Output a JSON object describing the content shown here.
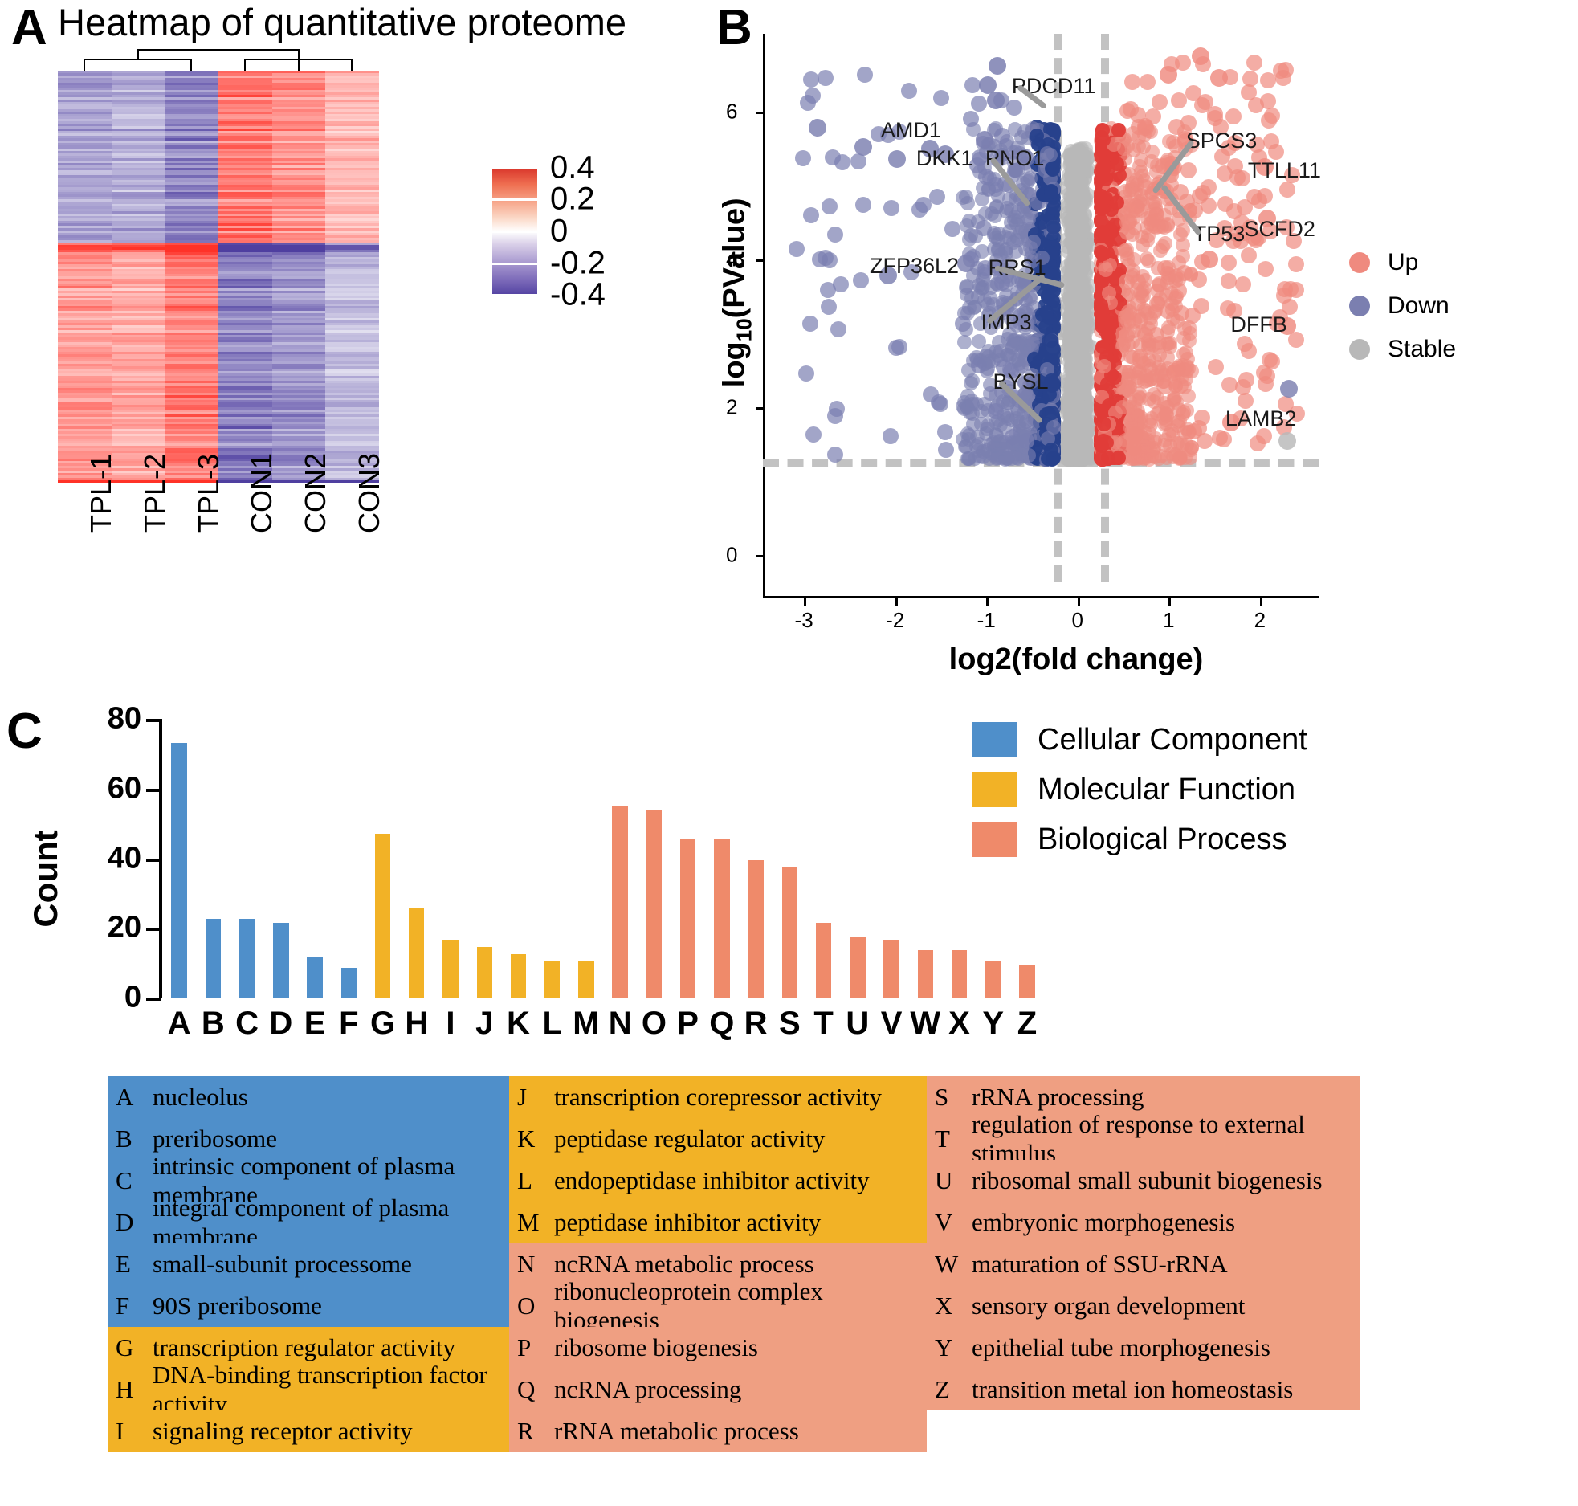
{
  "panels": {
    "a": "A",
    "b": "B",
    "c": "C"
  },
  "heatmap": {
    "title": "Heatmap of quantitative proteome",
    "columns": [
      "TPL-1",
      "TPL-2",
      "TPL-3",
      "CON1",
      "CON2",
      "CON3"
    ],
    "colorbar": {
      "ticks": [
        "0.4",
        "0.2",
        "0",
        "-0.2",
        "-0.4"
      ],
      "high_color": "#d73027",
      "mid_color": "#ffffff",
      "low_color": "#4f3fa0"
    }
  },
  "volcano": {
    "xlabel": "log2(fold change)",
    "ylabel_main": "log",
    "ylabel_sub": "10",
    "ylabel_tail": "(PValue)",
    "x_ticks": [
      "-3",
      "-2",
      "-1",
      "0",
      "1",
      "2"
    ],
    "y_ticks": [
      "0",
      "2",
      "4",
      "6"
    ],
    "legend": [
      {
        "label": "Up",
        "color": "#ef8a7f"
      },
      {
        "label": "Down",
        "color": "#7b7fb0"
      },
      {
        "label": "Stable",
        "color": "#b8b8b8"
      }
    ],
    "gene_labels": [
      "PDCD11",
      "AMD1",
      "DKK1",
      "PNO1",
      "SPCS3",
      "TTLL11",
      "SCFD2",
      "ZFP36L2",
      "RRS1",
      "TP53",
      "DFFB",
      "IMP3",
      "BYSL",
      "LAMB2"
    ],
    "thresholds": {
      "fc_left": -0.26,
      "fc_right": 0.26,
      "pvalue_line": 1.3
    }
  },
  "chart_data": {
    "type": "bar",
    "title": "",
    "xlabel": "",
    "ylabel": "Count",
    "ylim": [
      0,
      80
    ],
    "y_ticks": [
      0,
      20,
      40,
      60,
      80
    ],
    "categories": [
      "A",
      "B",
      "C",
      "D",
      "E",
      "F",
      "G",
      "H",
      "I",
      "J",
      "K",
      "L",
      "M",
      "N",
      "O",
      "P",
      "Q",
      "R",
      "S",
      "T",
      "U",
      "V",
      "W",
      "X",
      "Y",
      "Z"
    ],
    "values": [
      73,
      22.5,
      22.5,
      21.5,
      11.5,
      8.5,
      47,
      25.5,
      16.5,
      14.5,
      12.5,
      10.5,
      10.5,
      55,
      54,
      45.5,
      45.5,
      39.5,
      37.5,
      21.5,
      17.5,
      16.5,
      13.5,
      13.5,
      10.5,
      9.5
    ],
    "series": [
      {
        "name": "Cellular Component",
        "color": "#4f8fca",
        "categories": [
          "A",
          "B",
          "C",
          "D",
          "E",
          "F"
        ]
      },
      {
        "name": "Molecular Function",
        "color": "#f2b226",
        "categories": [
          "G",
          "H",
          "I",
          "J",
          "K",
          "L",
          "M"
        ]
      },
      {
        "name": "Biological Process",
        "color": "#ef8a6a",
        "categories": [
          "N",
          "O",
          "P",
          "Q",
          "R",
          "S",
          "T",
          "U",
          "V",
          "W",
          "X",
          "Y",
          "Z"
        ]
      }
    ],
    "legend": [
      {
        "label": "Cellular Component",
        "color": "#4f8fca"
      },
      {
        "label": "Molecular Function",
        "color": "#f2b226"
      },
      {
        "label": "Biological Process",
        "color": "#ef8a6a"
      }
    ],
    "legend_position": "top-right",
    "grid": false
  },
  "go_table": {
    "column1": [
      {
        "key": "A",
        "desc": "nucleolus",
        "cat": "cc"
      },
      {
        "key": "B",
        "desc": "preribosome",
        "cat": "cc"
      },
      {
        "key": "C",
        "desc": "intrinsic component of plasma membrane",
        "cat": "cc"
      },
      {
        "key": "D",
        "desc": "integral component of plasma membrane",
        "cat": "cc"
      },
      {
        "key": "E",
        "desc": "small-subunit processome",
        "cat": "cc"
      },
      {
        "key": "F",
        "desc": "90S preribosome",
        "cat": "cc"
      },
      {
        "key": "G",
        "desc": "transcription regulator activity",
        "cat": "mf"
      },
      {
        "key": "H",
        "desc": "DNA-binding transcription factor activity",
        "cat": "mf"
      },
      {
        "key": "I",
        "desc": "signaling receptor activity",
        "cat": "mf"
      }
    ],
    "column2": [
      {
        "key": "J",
        "desc": "transcription corepressor activity",
        "cat": "mf"
      },
      {
        "key": "K",
        "desc": "peptidase regulator activity",
        "cat": "mf"
      },
      {
        "key": "L",
        "desc": "endopeptidase inhibitor activity",
        "cat": "mf"
      },
      {
        "key": "M",
        "desc": "peptidase inhibitor activity",
        "cat": "mf"
      },
      {
        "key": "N",
        "desc": "ncRNA metabolic process",
        "cat": "bp"
      },
      {
        "key": "O",
        "desc": "ribonucleoprotein complex biogenesis",
        "cat": "bp"
      },
      {
        "key": "P",
        "desc": "ribosome biogenesis",
        "cat": "bp"
      },
      {
        "key": "Q",
        "desc": "ncRNA processing",
        "cat": "bp"
      },
      {
        "key": "R",
        "desc": "rRNA metabolic process",
        "cat": "bp"
      }
    ],
    "column3": [
      {
        "key": "S",
        "desc": "rRNA processing",
        "cat": "bp"
      },
      {
        "key": "T",
        "desc": "regulation of response to external stimulus",
        "cat": "bp"
      },
      {
        "key": "U",
        "desc": "ribosomal small subunit biogenesis",
        "cat": "bp"
      },
      {
        "key": "V",
        "desc": "embryonic morphogenesis",
        "cat": "bp"
      },
      {
        "key": "W",
        "desc": "maturation of SSU-rRNA",
        "cat": "bp"
      },
      {
        "key": "X",
        "desc": "sensory organ development",
        "cat": "bp"
      },
      {
        "key": "Y",
        "desc": "epithelial tube morphogenesis",
        "cat": "bp"
      },
      {
        "key": "Z",
        "desc": "transition metal ion homeostasis",
        "cat": "bp"
      },
      {
        "key": "",
        "desc": "",
        "cat": "blank"
      }
    ],
    "category_colors": {
      "cc": "#4f8fca",
      "mf": "#f2b226",
      "bp": "#ef9f82"
    }
  }
}
